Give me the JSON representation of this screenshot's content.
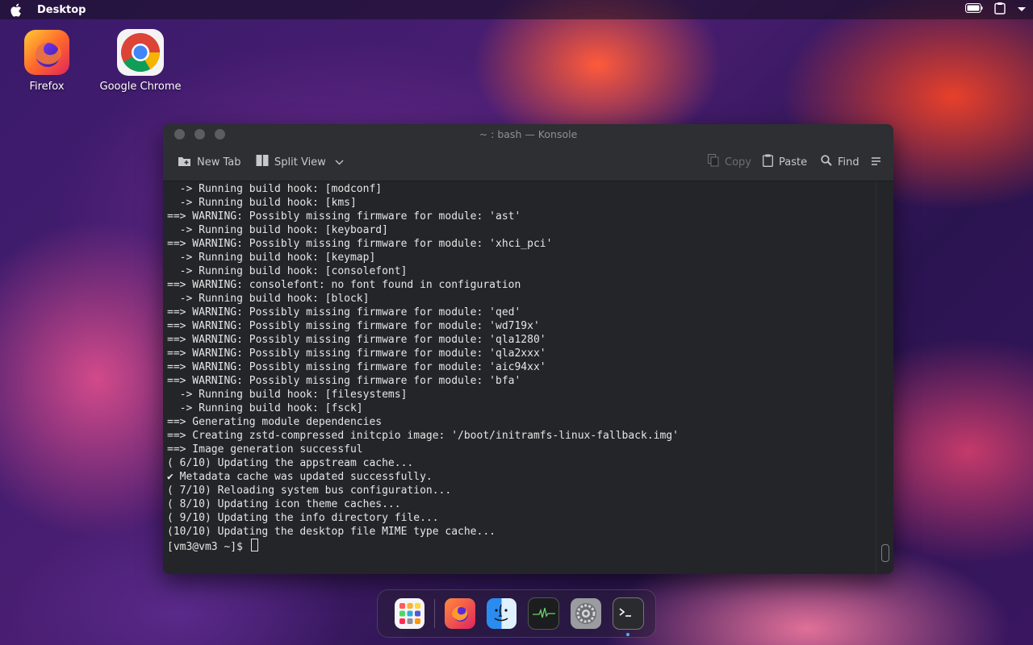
{
  "menubar": {
    "title": "Desktop",
    "icons": [
      "apple-icon",
      "battery-icon",
      "clipboard-icon",
      "chevron-down-icon"
    ]
  },
  "desktop_icons": [
    {
      "label": "Firefox",
      "icon": "firefox-icon"
    },
    {
      "label": "Google Chrome",
      "icon": "chrome-icon"
    }
  ],
  "window": {
    "title": "~ : bash — Konsole",
    "toolbar": {
      "new_tab": "New Tab",
      "split_view": "Split View",
      "copy": "Copy",
      "paste": "Paste",
      "find": "Find"
    },
    "terminal_lines": [
      "  -> Running build hook: [modconf]",
      "  -> Running build hook: [kms]",
      "==> WARNING: Possibly missing firmware for module: 'ast'",
      "  -> Running build hook: [keyboard]",
      "==> WARNING: Possibly missing firmware for module: 'xhci_pci'",
      "  -> Running build hook: [keymap]",
      "  -> Running build hook: [consolefont]",
      "==> WARNING: consolefont: no font found in configuration",
      "  -> Running build hook: [block]",
      "==> WARNING: Possibly missing firmware for module: 'qed'",
      "==> WARNING: Possibly missing firmware for module: 'wd719x'",
      "==> WARNING: Possibly missing firmware for module: 'qla1280'",
      "==> WARNING: Possibly missing firmware for module: 'qla2xxx'",
      "==> WARNING: Possibly missing firmware for module: 'aic94xx'",
      "==> WARNING: Possibly missing firmware for module: 'bfa'",
      "  -> Running build hook: [filesystems]",
      "  -> Running build hook: [fsck]",
      "==> Generating module dependencies",
      "==> Creating zstd-compressed initcpio image: '/boot/initramfs-linux-fallback.img'",
      "==> Image generation successful",
      "( 6/10) Updating the appstream cache...",
      "✔ Metadata cache was updated successfully.",
      "( 7/10) Reloading system bus configuration...",
      "( 8/10) Updating icon theme caches...",
      "( 9/10) Updating the info directory file...",
      "(10/10) Updating the desktop file MIME type cache..."
    ],
    "prompt": "[vm3@vm3 ~]$ "
  },
  "dock": {
    "items": [
      "launcher-icon",
      "firefox-icon",
      "finder-icon",
      "activity-monitor-icon",
      "settings-icon",
      "terminal-icon"
    ]
  }
}
